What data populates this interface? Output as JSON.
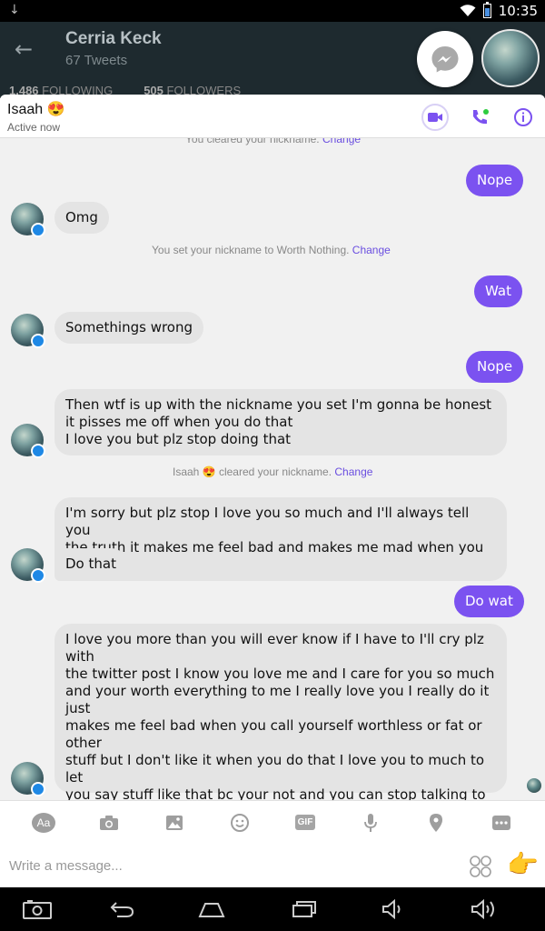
{
  "status_bar": {
    "time": "10:35",
    "download_icon": "↓"
  },
  "background_app": {
    "name": "Cerria Keck",
    "tweets": "67 Tweets",
    "following_count": "1,486",
    "following_label": "FOLLOWING",
    "followers_count": "505",
    "followers_label": "FOLLOWERS"
  },
  "conversation": {
    "title": "Isaah 😍",
    "status": "Active now"
  },
  "messages": [
    {
      "type": "system",
      "text": "You cleared your nickname.",
      "link": "Change"
    },
    {
      "type": "out",
      "text": "Nope"
    },
    {
      "type": "in",
      "text": "Omg"
    },
    {
      "type": "system",
      "text": "You set your nickname to Worth Nothing.",
      "link": "Change"
    },
    {
      "type": "out",
      "text": "Wat"
    },
    {
      "type": "in",
      "text": "Somethings wrong"
    },
    {
      "type": "out",
      "text": "Nope"
    },
    {
      "type": "in",
      "text": "Then wtf is up with the nickname you set I'm gonna be honest\nit pisses me off when you do that\nI love you but plz stop doing that"
    },
    {
      "type": "system",
      "text": "Isaah 😍 cleared your nickname.",
      "link": "Change"
    },
    {
      "type": "in",
      "text": "I'm sorry but plz stop I love you so much and I'll always tell you\nthe truth it makes me feel bad and makes me mad when you that"
    },
    {
      "type": "in",
      "text": "Do that"
    },
    {
      "type": "out",
      "text": "Do wat"
    },
    {
      "type": "in",
      "text": "I love you more than you will ever know if I have to I'll cry plz with\nthe twitter post I know you love me and I care for you so much\nand your worth everything to me I really love you I really do it just\nmakes me feel bad when you call yourself worthless or fat or other\nstuff but I don't like it when you do that I love you to much to let\nyou say stuff like that bc your not and you can stop talking to me\nbut I hope you forgive me for going off on you I just wanted you to\nknow how I feel  and I really want to cry bc of the twitter post but\nI'm not going to I love you and I'm sorry"
    }
  ],
  "composer": {
    "placeholder": "Write a message...",
    "gif_label": "GIF",
    "aa_label": "Aa",
    "like_emoji": "👉"
  },
  "colors": {
    "accent": "#7b52f0",
    "incoming_bubble": "#e4e4e4",
    "link": "#6a4ee0"
  }
}
